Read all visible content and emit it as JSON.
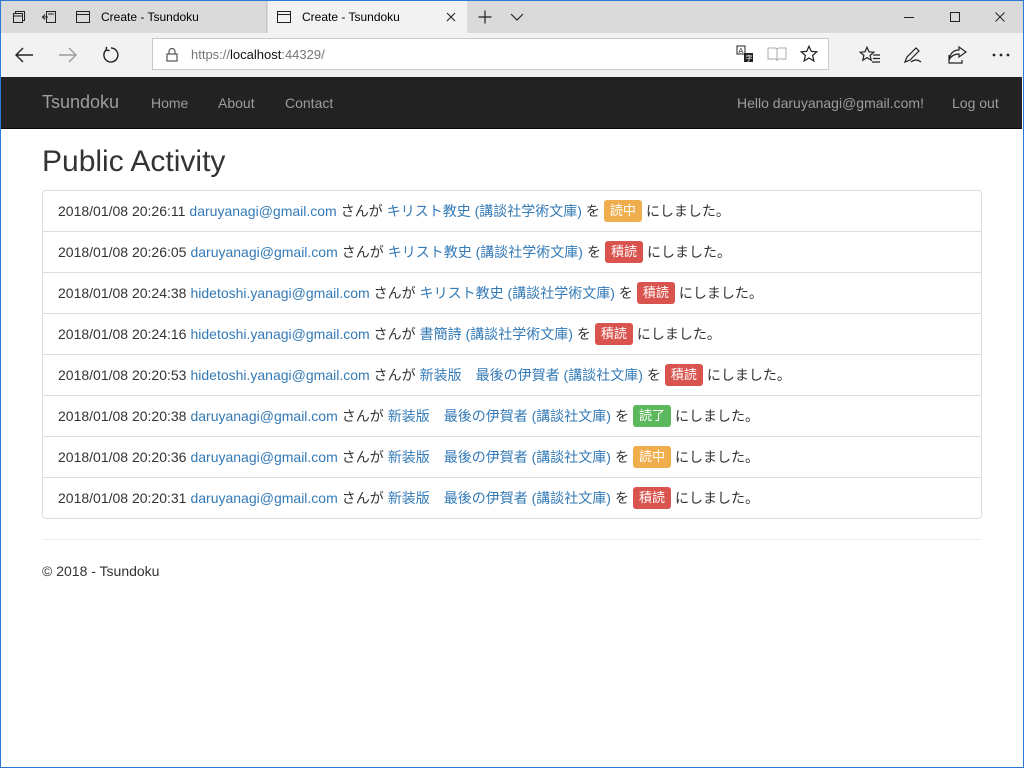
{
  "browser": {
    "tabs": [
      {
        "title": "Create - Tsundoku",
        "active": false
      },
      {
        "title": "Create - Tsundoku",
        "active": true
      }
    ],
    "url_scheme": "https://",
    "url_host": "localhost",
    "url_rest": ":44329/"
  },
  "site": {
    "brand": "Tsundoku",
    "nav": {
      "home": "Home",
      "about": "About",
      "contact": "Contact"
    },
    "hello": "Hello daruyanagi@gmail.com!",
    "logout": "Log out"
  },
  "page": {
    "title": "Public Activity"
  },
  "activity": [
    {
      "time": "2018/01/08 20:26:11",
      "user": "daruyanagi@gmail.com",
      "san": "さんが",
      "book": "キリスト教史 (講談社学術文庫)",
      "wo": "を",
      "status": "読中",
      "status_color": "#f0ad4e",
      "suffix": "にしました。"
    },
    {
      "time": "2018/01/08 20:26:05",
      "user": "daruyanagi@gmail.com",
      "san": "さんが",
      "book": "キリスト教史 (講談社学術文庫)",
      "wo": "を",
      "status": "積読",
      "status_color": "#d9534f",
      "suffix": "にしました。"
    },
    {
      "time": "2018/01/08 20:24:38",
      "user": "hidetoshi.yanagi@gmail.com",
      "san": "さんが",
      "book": "キリスト教史 (講談社学術文庫)",
      "wo": "を",
      "status": "積読",
      "status_color": "#d9534f",
      "suffix": "にしました。"
    },
    {
      "time": "2018/01/08 20:24:16",
      "user": "hidetoshi.yanagi@gmail.com",
      "san": "さんが",
      "book": "書簡詩 (講談社学術文庫)",
      "wo": "を",
      "status": "積読",
      "status_color": "#d9534f",
      "suffix": "にしました。"
    },
    {
      "time": "2018/01/08 20:20:53",
      "user": "hidetoshi.yanagi@gmail.com",
      "san": "さんが",
      "book": "新装版　最後の伊賀者 (講談社文庫)",
      "wo": "を",
      "status": "積読",
      "status_color": "#d9534f",
      "suffix": "にしました。"
    },
    {
      "time": "2018/01/08 20:20:38",
      "user": "daruyanagi@gmail.com",
      "san": "さんが",
      "book": "新装版　最後の伊賀者 (講談社文庫)",
      "wo": "を",
      "status": "読了",
      "status_color": "#5cb85c",
      "suffix": "にしました。"
    },
    {
      "time": "2018/01/08 20:20:36",
      "user": "daruyanagi@gmail.com",
      "san": "さんが",
      "book": "新装版　最後の伊賀者 (講談社文庫)",
      "wo": "を",
      "status": "読中",
      "status_color": "#f0ad4e",
      "suffix": "にしました。"
    },
    {
      "time": "2018/01/08 20:20:31",
      "user": "daruyanagi@gmail.com",
      "san": "さんが",
      "book": "新装版　最後の伊賀者 (講談社文庫)",
      "wo": "を",
      "status": "積読",
      "status_color": "#d9534f",
      "suffix": "にしました。"
    }
  ],
  "footer": {
    "text": "© 2018 - Tsundoku"
  },
  "colors": {
    "accent_link": "#337ab7",
    "navbar_bg": "#222222",
    "window_border": "#2b7bd4"
  },
  "icons": {
    "tabstrip": [
      "tab-manager-icon",
      "set-aside-tabs-icon",
      "page-icon",
      "close-icon",
      "new-tab-icon",
      "tab-preview-chevron-icon"
    ],
    "window": [
      "minimize-icon",
      "maximize-icon",
      "window-close-icon"
    ],
    "navigation": [
      "back-icon",
      "forward-icon",
      "refresh-icon",
      "lock-icon",
      "translate-icon",
      "reading-view-icon",
      "favorite-star-icon",
      "favorites-hub-icon",
      "pen-icon",
      "share-icon",
      "more-icon"
    ]
  }
}
